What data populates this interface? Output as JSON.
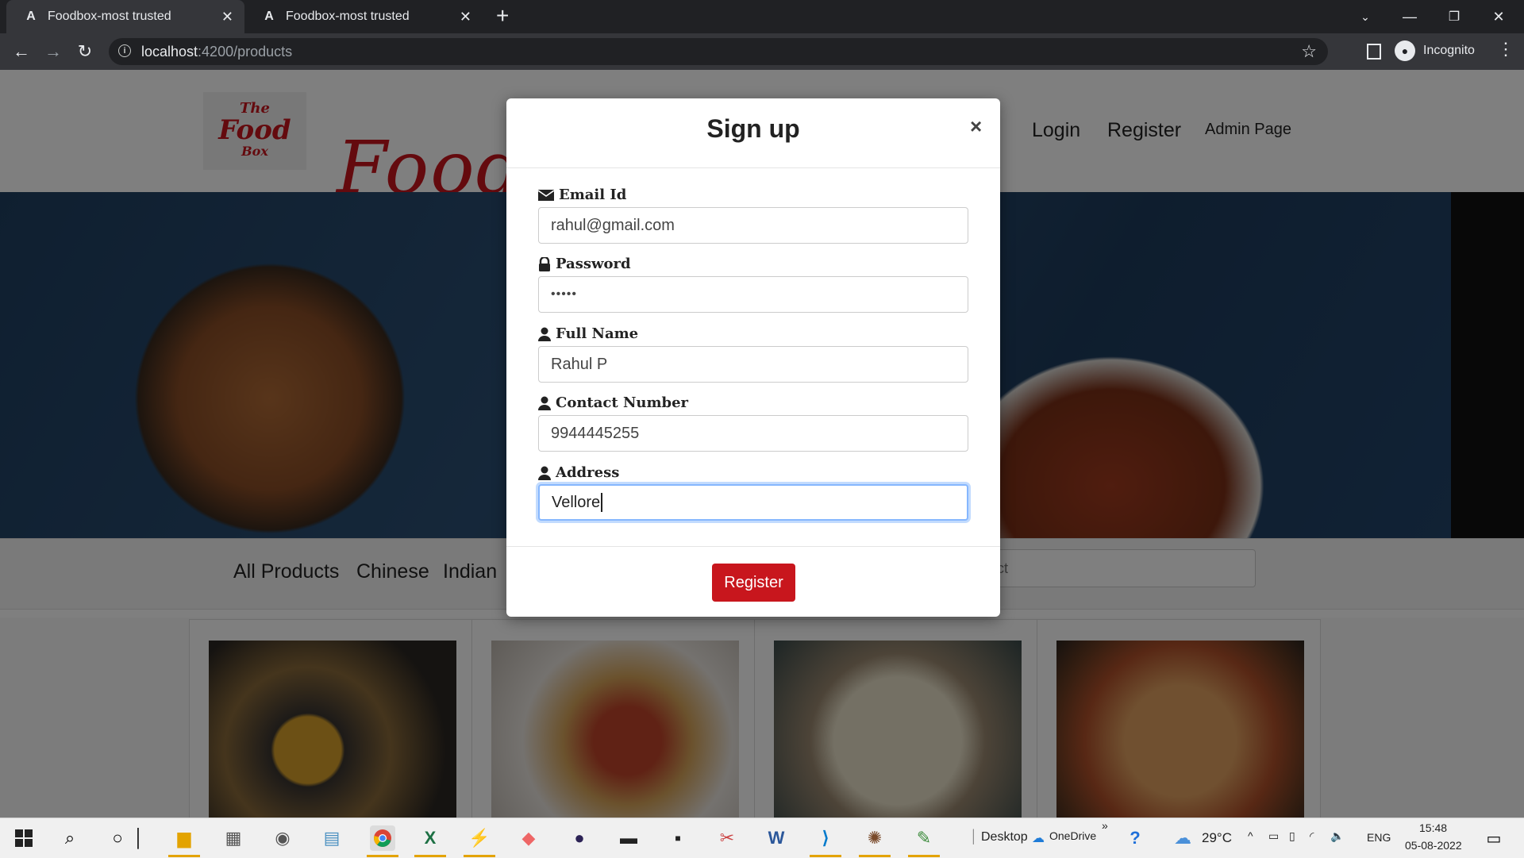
{
  "browser": {
    "tabs": [
      {
        "title": "Foodbox-most trusted",
        "active": true
      },
      {
        "title": "Foodbox-most trusted",
        "active": false
      }
    ],
    "url_host": "localhost",
    "url_path": ":4200/products",
    "profile_label": "Incognito"
  },
  "site": {
    "logo_line1": "The",
    "logo_line2": "Food",
    "logo_line3": "Box",
    "brand_text": "Foodbox",
    "nav": {
      "login": "Login",
      "register": "Register",
      "admin": "Admin Page"
    },
    "categories": [
      "All Products",
      "Chinese",
      "Indian"
    ],
    "search_placeholder": "Search Product",
    "search_visible_fragment": "duct"
  },
  "modal": {
    "title": "Sign up",
    "close": "×",
    "fields": [
      {
        "label": "Email Id",
        "icon": "envelope-icon",
        "value": "rahul@gmail.com"
      },
      {
        "label": "Password",
        "icon": "lock-icon",
        "value": "•••••"
      },
      {
        "label": "Full Name",
        "icon": "user-icon",
        "value": "Rahul P"
      },
      {
        "label": "Contact Number",
        "icon": "user-icon",
        "value": "9944445255"
      },
      {
        "label": "Address",
        "icon": "user-icon",
        "value": "Vellore"
      }
    ],
    "submit_label": "Register",
    "accent": "#c8161d"
  },
  "taskbar": {
    "desktop_label": "Desktop",
    "onedrive_label": "OneDrive",
    "temperature": "29°C",
    "language": "ENG",
    "time": "15:48",
    "date": "05-08-2022"
  }
}
